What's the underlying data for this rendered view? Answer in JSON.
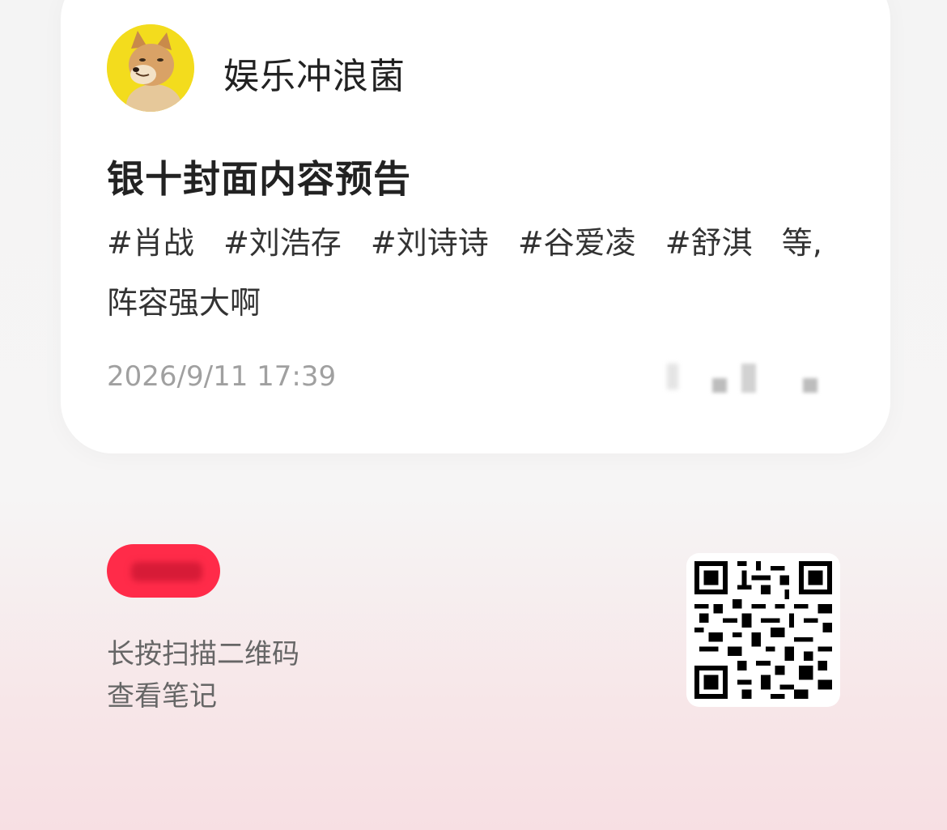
{
  "author": {
    "name": "娱乐冲浪菌",
    "avatar_icon": "shiba-dog-avatar-icon"
  },
  "post": {
    "title": "银十封面内容预告",
    "tags": [
      "#肖战",
      "#刘浩存",
      "#刘诗诗",
      "#谷爱凌",
      "#舒淇"
    ],
    "tags_suffix": "等,",
    "body_line2": "阵容强大啊",
    "date": "2026/9/11 17:39"
  },
  "share": {
    "line1": "长按扫描二维码",
    "line2": "查看笔记",
    "qr_icon": "qr-code-icon"
  },
  "colors": {
    "badge": "#ff2b49",
    "avatar_bg": "#f3dc1d"
  }
}
